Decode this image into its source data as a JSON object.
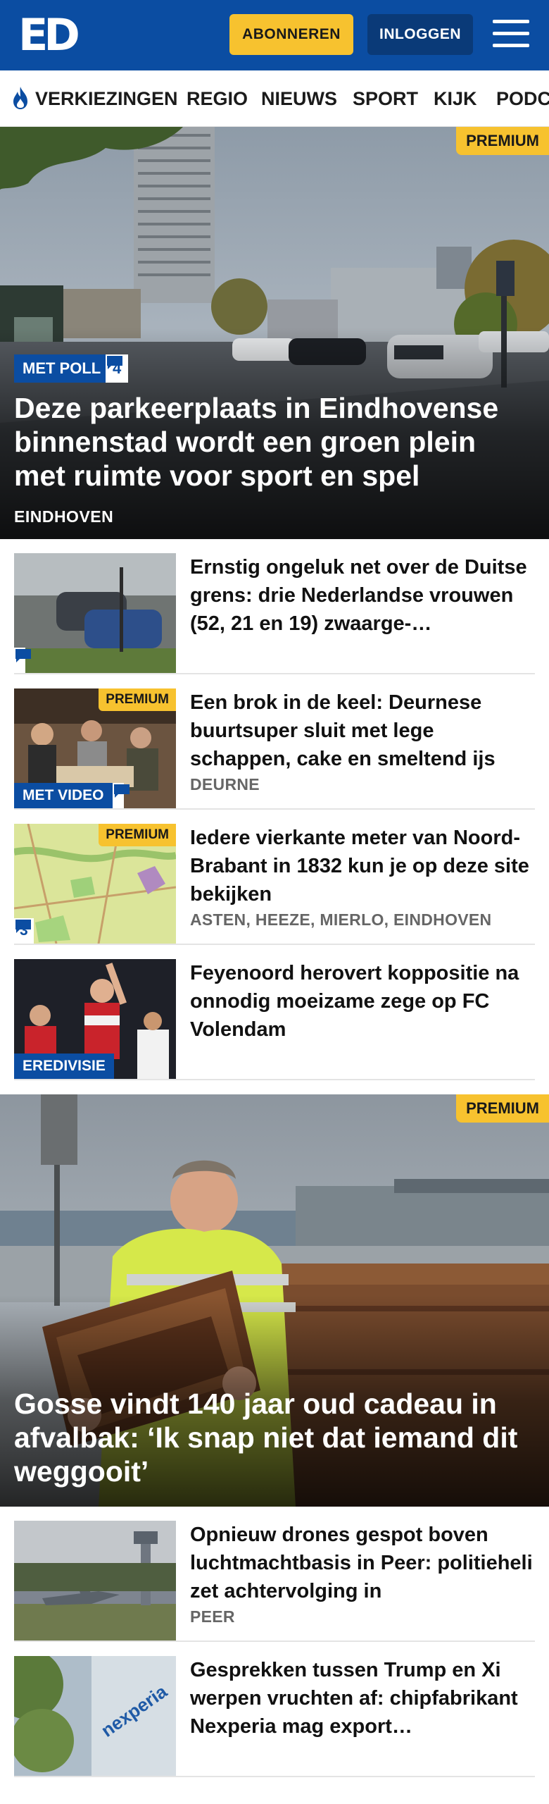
{
  "header": {
    "logo": "ED",
    "subscribe_label": "ABONNEREN",
    "login_label": "INLOGGEN"
  },
  "nav": {
    "items": [
      "VERKIEZINGEN",
      "REGIO",
      "NIEUWS",
      "SPORT",
      "KIJK",
      "PODC"
    ]
  },
  "hero": {
    "premium": "PREMIUM",
    "tag": "MET POLL",
    "comments": "4",
    "title": "Deze parkeerplaats in Eindhovense binnenstad wordt een groen plein met ruimte voor sport en spel",
    "location": "EINDHOVEN"
  },
  "articles": [
    {
      "title": "Ernstig ongeluk net over de Duitse grens: drie Nederlandse vrouwen (52, 21 en 19) zwaarge-…",
      "location": "",
      "premium": "",
      "tag": "",
      "comments": ""
    },
    {
      "title": "Een brok in de keel: Deurnese buurtsuper sluit met lege schappen, cake en smeltend ijs",
      "location": "DEURNE",
      "premium": "PREMIUM",
      "tag": "MET VIDEO",
      "comments": ""
    },
    {
      "title": "Iedere vierkante meter van Noord-Brabant in 1832 kun je op deze site bekijken",
      "location": "ASTEN, HEEZE, MIERLO, EINDHOVEN",
      "premium": "PREMIUM",
      "tag": "",
      "comments": "3"
    },
    {
      "title": "Feyenoord herovert kopp­ositie na onnodig moeizame zege op FC Volendam",
      "location": "",
      "premium": "",
      "tag": "EREDIVISIE",
      "comments": ""
    }
  ],
  "hero2": {
    "premium": "PREMIUM",
    "title": "Gosse vindt 140 jaar oud cadeau in afvalbak: ‘Ik snap niet dat iemand dit weggooit’"
  },
  "articles2": [
    {
      "title": "Opnieuw drones gespot boven luchtmachtbasis in Peer: politieheli zet achtervolging in",
      "location": "PEER"
    },
    {
      "title": "Gesprekken tussen Trump en Xi werpen vruchten af: chipfabri­kant Nexperia mag export…",
      "location": ""
    }
  ],
  "icons": {
    "menu": "hamburger-menu-icon",
    "flame": "flame-icon",
    "comment": "comment-bubble-icon"
  },
  "colors": {
    "brand_blue": "#0b4da2",
    "premium_yellow": "#f7c22f",
    "login_button": "#0a3a78"
  }
}
